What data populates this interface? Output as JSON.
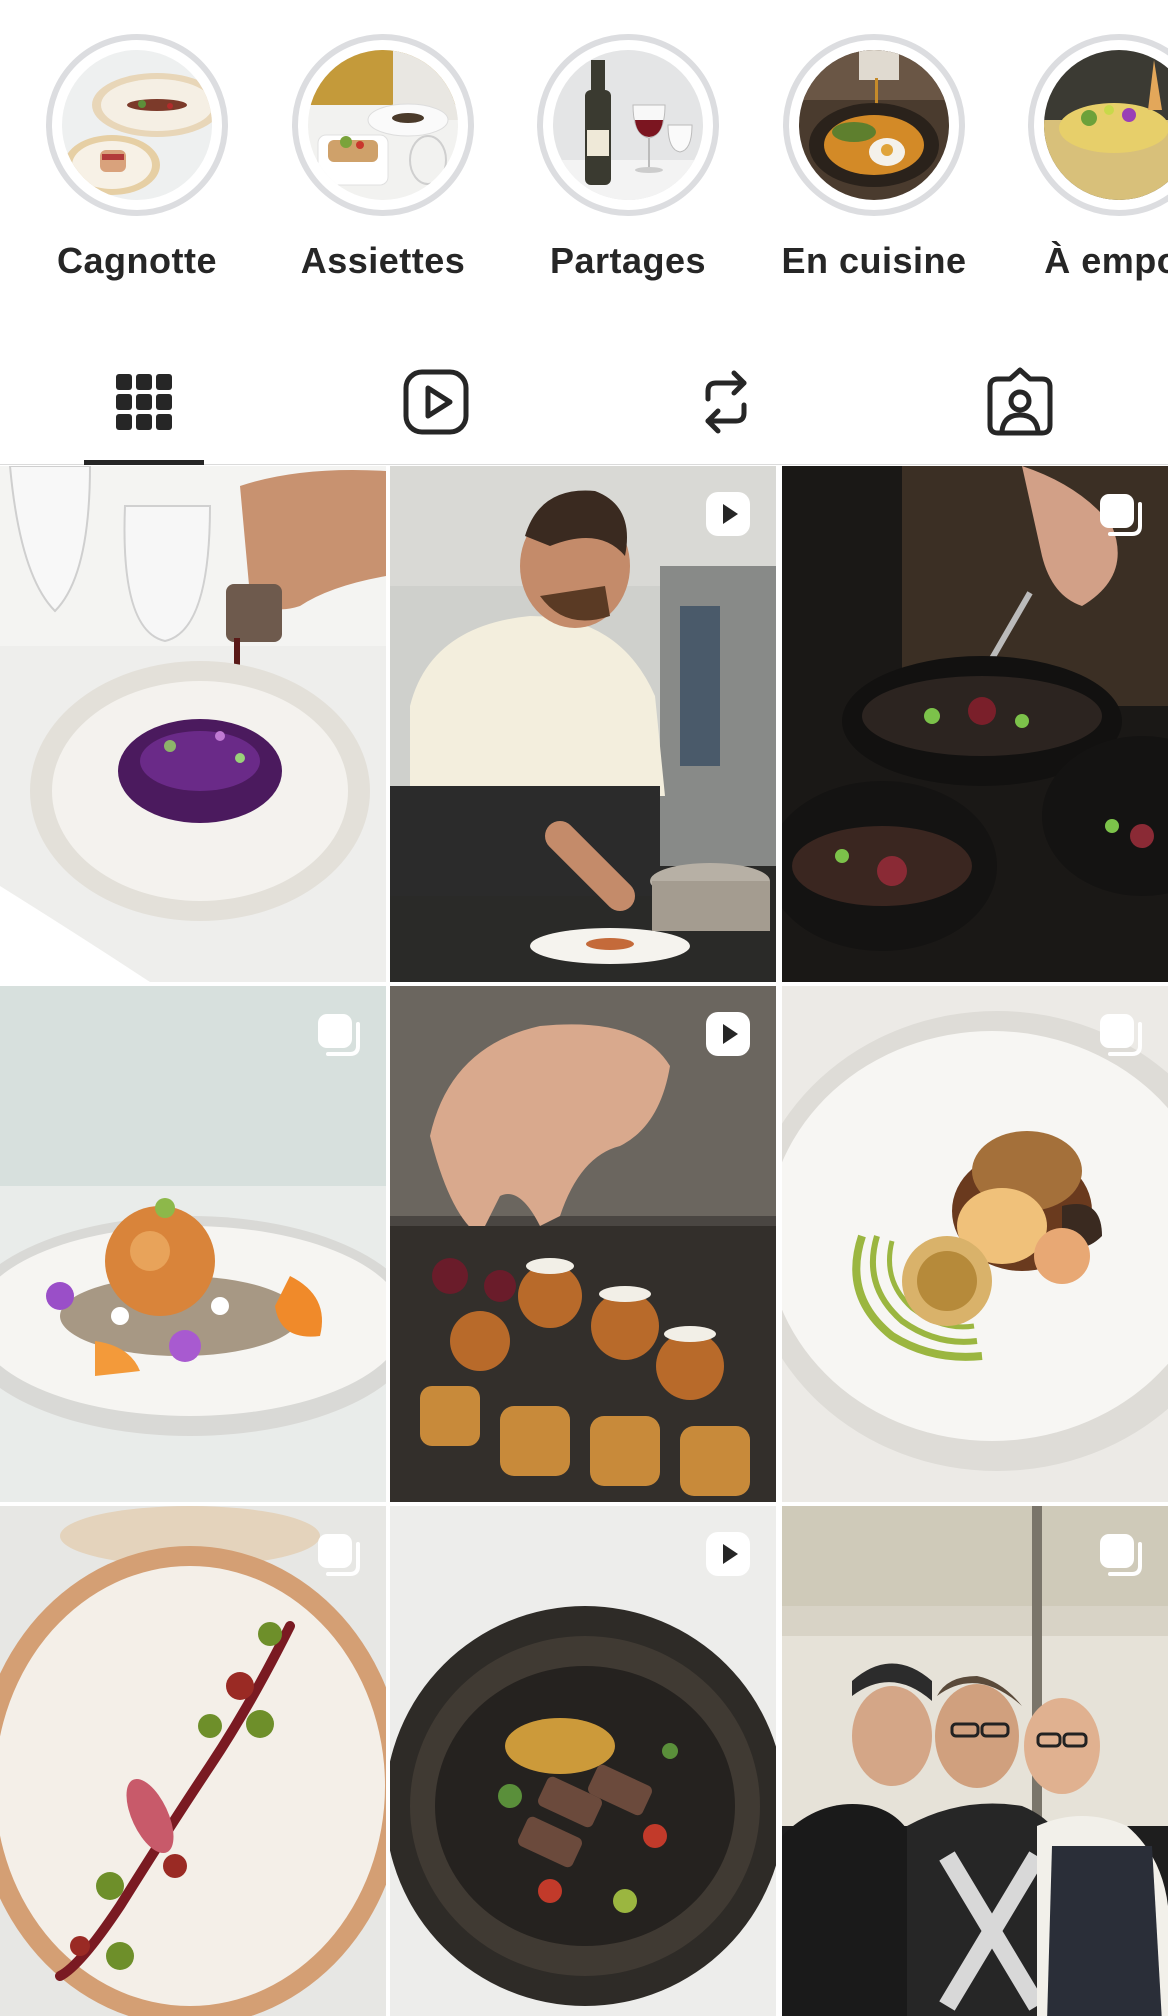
{
  "highlights": [
    {
      "label": "Cagnotte",
      "icon": "plated-dish-photo"
    },
    {
      "label": "Assiettes",
      "icon": "dessert-plate-photo"
    },
    {
      "label": "Partages",
      "icon": "wine-bottle-photo"
    },
    {
      "label": "En cuisine",
      "icon": "sauce-pouring-photo"
    },
    {
      "label": "À empor",
      "icon": "takeaway-dish-photo"
    }
  ],
  "tabs": [
    {
      "name": "posts-grid",
      "icon": "grid-icon",
      "active": true
    },
    {
      "name": "reels",
      "icon": "reels-icon",
      "active": false
    },
    {
      "name": "reposts",
      "icon": "repost-icon",
      "active": false
    },
    {
      "name": "tagged",
      "icon": "tagged-person-icon",
      "active": false
    }
  ],
  "posts": [
    {
      "subject": "sauce-pouring-purple-dish",
      "type": "image"
    },
    {
      "subject": "chef-plating",
      "type": "reel"
    },
    {
      "subject": "bowls-spooning",
      "type": "carousel"
    },
    {
      "subject": "orange-sphere-dish",
      "type": "carousel"
    },
    {
      "subject": "petit-fours-tray",
      "type": "reel"
    },
    {
      "subject": "mushroom-dish-green-sauce",
      "type": "carousel"
    },
    {
      "subject": "line-garnish-plate",
      "type": "carousel"
    },
    {
      "subject": "seared-tuna-black-bowl",
      "type": "reel"
    },
    {
      "subject": "three-chefs",
      "type": "carousel"
    }
  ],
  "colors": {
    "text": "#262626",
    "ring": "#dcdde0",
    "divider": "#dbdbdb",
    "badge": "#ffffff"
  }
}
